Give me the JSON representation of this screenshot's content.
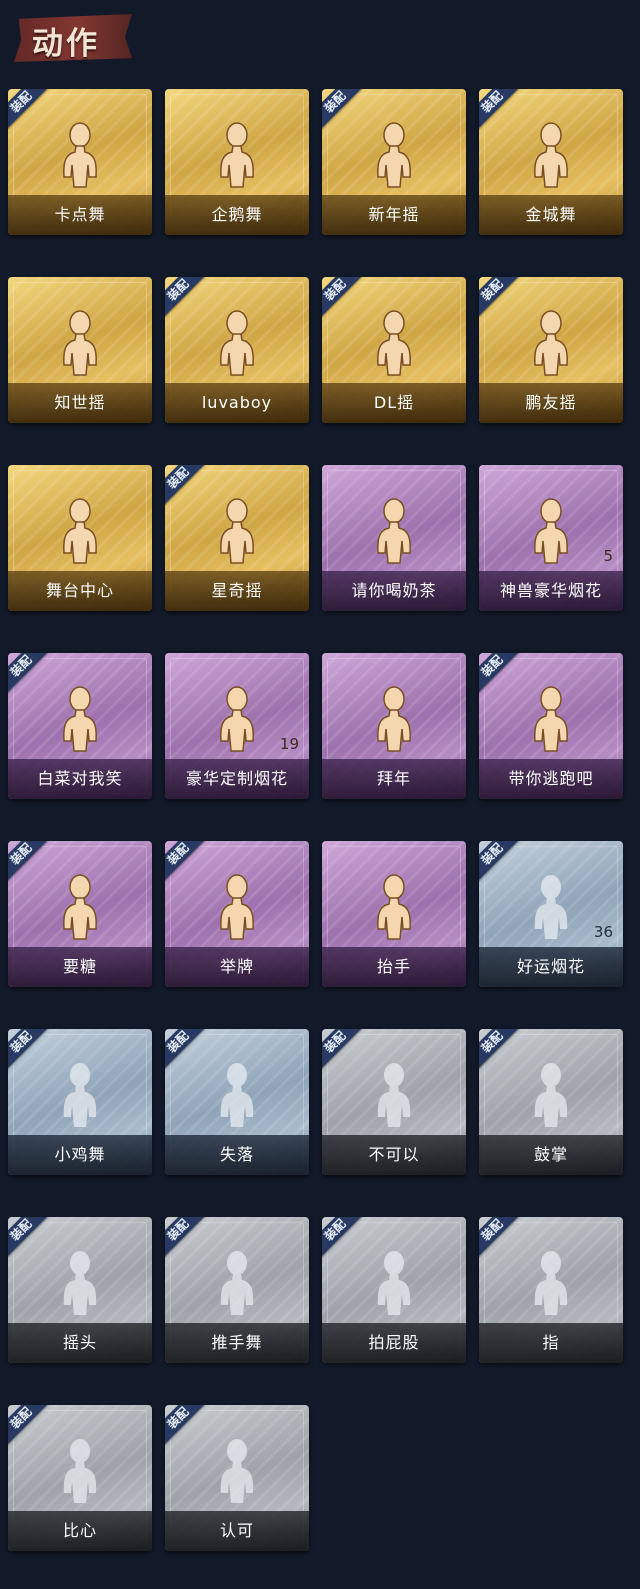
{
  "header": {
    "title": "动作"
  },
  "badge_text": "装配",
  "items": [
    {
      "name": "卡点舞",
      "tier": "gold",
      "equipped": true,
      "count": ""
    },
    {
      "name": "企鹅舞",
      "tier": "gold",
      "equipped": false,
      "count": ""
    },
    {
      "name": "新年摇",
      "tier": "gold",
      "equipped": true,
      "count": ""
    },
    {
      "name": "金城舞",
      "tier": "gold",
      "equipped": true,
      "count": ""
    },
    {
      "name": "知世摇",
      "tier": "gold",
      "equipped": false,
      "count": ""
    },
    {
      "name": "luvaboy",
      "tier": "gold",
      "equipped": true,
      "count": ""
    },
    {
      "name": "DL摇",
      "tier": "gold",
      "equipped": true,
      "count": ""
    },
    {
      "name": "鹏友摇",
      "tier": "gold",
      "equipped": true,
      "count": ""
    },
    {
      "name": "舞台中心",
      "tier": "gold",
      "equipped": false,
      "count": ""
    },
    {
      "name": "星奇摇",
      "tier": "gold",
      "equipped": true,
      "count": ""
    },
    {
      "name": "请你喝奶茶",
      "tier": "purple",
      "equipped": false,
      "count": ""
    },
    {
      "name": "神兽豪华烟花",
      "tier": "purple",
      "equipped": false,
      "count": "5"
    },
    {
      "name": "白菜对我笑",
      "tier": "purple",
      "equipped": true,
      "count": ""
    },
    {
      "name": "豪华定制烟花",
      "tier": "purple",
      "equipped": false,
      "count": "19"
    },
    {
      "name": "拜年",
      "tier": "purple",
      "equipped": false,
      "count": ""
    },
    {
      "name": "带你逃跑吧",
      "tier": "purple",
      "equipped": true,
      "count": ""
    },
    {
      "name": "要糖",
      "tier": "purple",
      "equipped": true,
      "count": ""
    },
    {
      "name": "举牌",
      "tier": "purple",
      "equipped": true,
      "count": ""
    },
    {
      "name": "抬手",
      "tier": "purple",
      "equipped": false,
      "count": ""
    },
    {
      "name": "好运烟花",
      "tier": "blue",
      "equipped": true,
      "count": "36"
    },
    {
      "name": "小鸡舞",
      "tier": "blue",
      "equipped": true,
      "count": ""
    },
    {
      "name": "失落",
      "tier": "blue",
      "equipped": true,
      "count": ""
    },
    {
      "name": "不可以",
      "tier": "gray",
      "equipped": true,
      "count": ""
    },
    {
      "name": "鼓掌",
      "tier": "gray",
      "equipped": true,
      "count": ""
    },
    {
      "name": "摇头",
      "tier": "gray",
      "equipped": true,
      "count": ""
    },
    {
      "name": "推手舞",
      "tier": "gray",
      "equipped": true,
      "count": ""
    },
    {
      "name": "拍屁股",
      "tier": "gray",
      "equipped": true,
      "count": ""
    },
    {
      "name": "指",
      "tier": "gray",
      "equipped": true,
      "count": ""
    },
    {
      "name": "比心",
      "tier": "gray",
      "equipped": true,
      "count": ""
    },
    {
      "name": "认可",
      "tier": "gray",
      "equipped": true,
      "count": ""
    }
  ]
}
